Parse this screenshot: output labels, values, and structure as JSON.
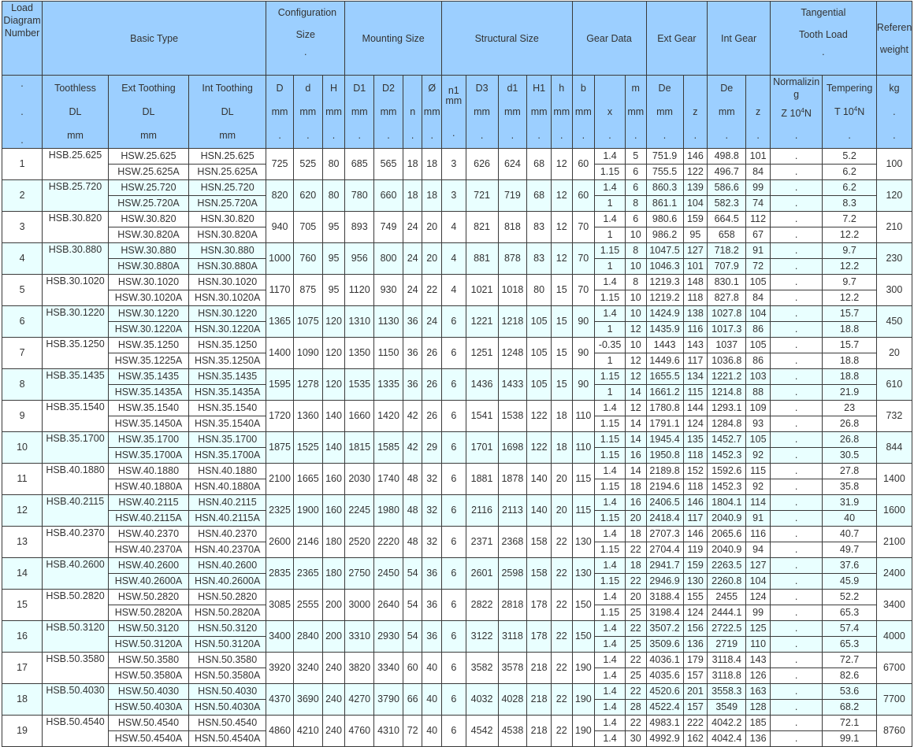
{
  "header": {
    "load_diagram": "Load Diagram Number",
    "basic_type": "Basic Type",
    "configuration_size": "Configuration Size",
    "mounting_size": "Mounting Size",
    "structural_size": "Structural Size",
    "gear_data": "Gear Data",
    "ext_gear": "Ext Gear",
    "int_gear": "Int Gear",
    "tangential_tooth_load": "Tangential Tooth Load",
    "reference_weight": "Reference weight",
    "dot": ".",
    "toothless": "Toothless",
    "toothless_dl": "DL",
    "toothless_mm": "mm",
    "ext_toothing": "Ext Toothing",
    "ext_dl": "DL",
    "ext_mm": "mm",
    "int_toothing": "Int Toothing",
    "int_dl": "DL",
    "int_mm": "mm",
    "D": "D",
    "d": "d",
    "H": "H",
    "D1": "D1",
    "D2": "D2",
    "n": "n",
    "phi": "Ø",
    "n1": "n1",
    "D3": "D3",
    "d1": "d1",
    "H1": "H1",
    "h": "h",
    "b": "b",
    "x": "x",
    "m": "m",
    "De_ext": "De",
    "z_ext": "z",
    "De_int": "De",
    "z_int": "z",
    "mm": "mm",
    "normalizing": "Normalizing",
    "normalizing_unit": "Z 10",
    "tempering": "Tempering",
    "tempering_unit": "T 10",
    "power": "4",
    "newton": "N",
    "kg": "kg"
  },
  "rows": [
    {
      "no": "1",
      "tl": "HSB.25.625",
      "ext": [
        "HSW.25.625",
        "HSW.25.625A"
      ],
      "int": [
        "HSN.25.625",
        "HSN.25.625A"
      ],
      "D": "725",
      "d": "525",
      "H": "80",
      "D1": "685",
      "D2": "565",
      "n": "18",
      "phi": "18",
      "n1": "3",
      "D3": "626",
      "d1": "624",
      "H1": "68",
      "h": "12",
      "b": "60",
      "x": [
        "1.4",
        "1.15"
      ],
      "m": [
        "5",
        "6"
      ],
      "De": [
        "751.9",
        "755.5"
      ],
      "z": [
        "146",
        "122"
      ],
      "Dei": [
        "498.8",
        "496.7"
      ],
      "zi": [
        "101",
        "84"
      ],
      "norm": [
        ".",
        "."
      ],
      "temp": [
        "5.2",
        "6.2"
      ],
      "kg": "100"
    },
    {
      "no": "2",
      "tl": "HSB.25.720",
      "ext": [
        "HSW.25.720",
        "HSW.25.720A"
      ],
      "int": [
        "HSN.25.720",
        "HSN.25.720A"
      ],
      "D": "820",
      "d": "620",
      "H": "80",
      "D1": "780",
      "D2": "660",
      "n": "18",
      "phi": "18",
      "n1": "3",
      "D3": "721",
      "d1": "719",
      "H1": "68",
      "h": "12",
      "b": "60",
      "x": [
        "1.4",
        "1"
      ],
      "m": [
        "6",
        "8"
      ],
      "De": [
        "860.3",
        "861.1"
      ],
      "z": [
        "139",
        "104"
      ],
      "Dei": [
        "586.6",
        "582.3"
      ],
      "zi": [
        "99",
        "74"
      ],
      "norm": [
        ".",
        "."
      ],
      "temp": [
        "6.2",
        "8.3"
      ],
      "kg": "120"
    },
    {
      "no": "3",
      "tl": "HSB.30.820",
      "ext": [
        "HSW.30.820",
        "HSW.30.820A"
      ],
      "int": [
        "HSN.30.820",
        "HSN.30.820A"
      ],
      "D": "940",
      "d": "705",
      "H": "95",
      "D1": "893",
      "D2": "749",
      "n": "24",
      "phi": "20",
      "n1": "4",
      "D3": "821",
      "d1": "818",
      "H1": "83",
      "h": "12",
      "b": "70",
      "x": [
        "1.4",
        "1"
      ],
      "m": [
        "6",
        "10"
      ],
      "De": [
        "980.6",
        "986.2"
      ],
      "z": [
        "159",
        "95"
      ],
      "Dei": [
        "664.5",
        "658"
      ],
      "zi": [
        "112",
        "67"
      ],
      "norm": [
        ".",
        "."
      ],
      "temp": [
        "7.2",
        "12.2"
      ],
      "kg": "210"
    },
    {
      "no": "4",
      "tl": "HSB.30.880",
      "ext": [
        "HSW.30.880",
        "HSW.30.880A"
      ],
      "int": [
        "HSN.30.880",
        "HSN.30.880A"
      ],
      "D": "1000",
      "d": "760",
      "H": "95",
      "D1": "956",
      "D2": "800",
      "n": "24",
      "phi": "20",
      "n1": "4",
      "D3": "881",
      "d1": "878",
      "H1": "83",
      "h": "12",
      "b": "70",
      "x": [
        "1.15",
        "1"
      ],
      "m": [
        "8",
        "10"
      ],
      "De": [
        "1047.5",
        "1046.3"
      ],
      "z": [
        "127",
        "101"
      ],
      "Dei": [
        "718.2",
        "707.9"
      ],
      "zi": [
        "91",
        "72"
      ],
      "norm": [
        ".",
        "."
      ],
      "temp": [
        "9.7",
        "12.2"
      ],
      "kg": "230"
    },
    {
      "no": "5",
      "tl": "HSB.30.1020",
      "ext": [
        "HSW.30.1020",
        "HSW.30.1020A"
      ],
      "int": [
        "HSN.30.1020",
        "HSN.30.1020A"
      ],
      "D": "1170",
      "d": "875",
      "H": "95",
      "D1": "1120",
      "D2": "930",
      "n": "24",
      "phi": "22",
      "n1": "4",
      "D3": "1021",
      "d1": "1018",
      "H1": "80",
      "h": "15",
      "b": "70",
      "x": [
        "1.4",
        "1.15"
      ],
      "m": [
        "8",
        "10"
      ],
      "De": [
        "1219.3",
        "1219.2"
      ],
      "z": [
        "148",
        "118"
      ],
      "Dei": [
        "830.1",
        "827.8"
      ],
      "zi": [
        "105",
        "84"
      ],
      "norm": [
        ".",
        "."
      ],
      "temp": [
        "9.7",
        "12.2"
      ],
      "kg": "300"
    },
    {
      "no": "6",
      "tl": "HSB.30.1220",
      "ext": [
        "HSW.30.1220",
        "HSW.30.1220A"
      ],
      "int": [
        "HSN.30.1220",
        "HSN.30.1220A"
      ],
      "D": "1365",
      "d": "1075",
      "H": "120",
      "D1": "1310",
      "D2": "1130",
      "n": "36",
      "phi": "24",
      "n1": "6",
      "D3": "1221",
      "d1": "1218",
      "H1": "105",
      "h": "15",
      "b": "90",
      "x": [
        "1.4",
        "1"
      ],
      "m": [
        "10",
        "12"
      ],
      "De": [
        "1424.9",
        "1435.9"
      ],
      "z": [
        "138",
        "116"
      ],
      "Dei": [
        "1027.8",
        "1017.3"
      ],
      "zi": [
        "104",
        "86"
      ],
      "norm": [
        ".",
        "."
      ],
      "temp": [
        "15.7",
        "18.8"
      ],
      "kg": "450"
    },
    {
      "no": "7",
      "tl": "HSB.35.1250",
      "ext": [
        "HSW.35.1250",
        "HSW.35.1225A"
      ],
      "int": [
        "HSN.35.1250",
        "HSN.35.1250A"
      ],
      "D": "1400",
      "d": "1090",
      "H": "120",
      "D1": "1350",
      "D2": "1150",
      "n": "36",
      "phi": "26",
      "n1": "6",
      "D3": "1251",
      "d1": "1248",
      "H1": "105",
      "h": "15",
      "b": "90",
      "x": [
        "-0.35",
        "1"
      ],
      "m": [
        "10",
        "12"
      ],
      "De": [
        "1443",
        "1449.6"
      ],
      "z": [
        "143",
        "117"
      ],
      "Dei": [
        "1037",
        "1036.8"
      ],
      "zi": [
        "105",
        "86"
      ],
      "norm": [
        ".",
        "."
      ],
      "temp": [
        "15.7",
        "18.8"
      ],
      "kg": "20"
    },
    {
      "no": "8",
      "tl": "HSB.35.1435",
      "ext": [
        "HSW.35.1435",
        "HSW.35.1435A"
      ],
      "int": [
        "HSN.35.1435",
        "HSN.35.1435A"
      ],
      "D": "1595",
      "d": "1278",
      "H": "120",
      "D1": "1535",
      "D2": "1335",
      "n": "36",
      "phi": "26",
      "n1": "6",
      "D3": "1436",
      "d1": "1433",
      "H1": "105",
      "h": "15",
      "b": "90",
      "x": [
        "1.15",
        "1"
      ],
      "m": [
        "12",
        "14"
      ],
      "De": [
        "1655.5",
        "1661.2"
      ],
      "z": [
        "134",
        "115"
      ],
      "Dei": [
        "1221.2",
        "1214.8"
      ],
      "zi": [
        "103",
        "88"
      ],
      "norm": [
        ".",
        "."
      ],
      "temp": [
        "18.8",
        "21.9"
      ],
      "kg": "610"
    },
    {
      "no": "9",
      "tl": "HSB.35.1540",
      "ext": [
        "HSW.35.1540",
        "HSW.35.1450A"
      ],
      "int": [
        "HSN.35.1540",
        "HSN.35.1540A"
      ],
      "D": "1720",
      "d": "1360",
      "H": "140",
      "D1": "1660",
      "D2": "1420",
      "n": "42",
      "phi": "26",
      "n1": "6",
      "D3": "1541",
      "d1": "1538",
      "H1": "122",
      "h": "18",
      "b": "110",
      "x": [
        "1.4",
        "1.15"
      ],
      "m": [
        "12",
        "14"
      ],
      "De": [
        "1780.8",
        "1791.1"
      ],
      "z": [
        "144",
        "124"
      ],
      "Dei": [
        "1293.1",
        "1284.8"
      ],
      "zi": [
        "109",
        "93"
      ],
      "norm": [
        ".",
        "."
      ],
      "temp": [
        "23",
        "26.8"
      ],
      "kg": "732"
    },
    {
      "no": "10",
      "tl": "HSB.35.1700",
      "ext": [
        "HSW.35.1700",
        "HSW.35.1700A"
      ],
      "int": [
        "HSN.35.1700",
        "HSN.35.1700A"
      ],
      "D": "1875",
      "d": "1525",
      "H": "140",
      "D1": "1815",
      "D2": "1585",
      "n": "42",
      "phi": "29",
      "n1": "6",
      "D3": "1701",
      "d1": "1698",
      "H1": "122",
      "h": "18",
      "b": "110",
      "x": [
        "1.15",
        "1.15"
      ],
      "m": [
        "14",
        "16"
      ],
      "De": [
        "1945.4",
        "1950.8"
      ],
      "z": [
        "135",
        "118"
      ],
      "Dei": [
        "1452.7",
        "1452.3"
      ],
      "zi": [
        "105",
        "92"
      ],
      "norm": [
        ".",
        "."
      ],
      "temp": [
        "26.8",
        "30.5"
      ],
      "kg": "844"
    },
    {
      "no": "11",
      "tl": "HSB.40.1880",
      "ext": [
        "HSW.40.1880",
        "HSW.40.1880A"
      ],
      "int": [
        "HSN.40.1880",
        "HSN.40.1880A"
      ],
      "D": "2100",
      "d": "1665",
      "H": "160",
      "D1": "2030",
      "D2": "1740",
      "n": "48",
      "phi": "32",
      "n1": "6",
      "D3": "1881",
      "d1": "1878",
      "H1": "140",
      "h": "20",
      "b": "115",
      "x": [
        "1.4",
        "1.15"
      ],
      "m": [
        "14",
        "18"
      ],
      "De": [
        "2189.8",
        "2194.6"
      ],
      "z": [
        "152",
        "118"
      ],
      "Dei": [
        "1592.6",
        "1452.3"
      ],
      "zi": [
        "115",
        "92"
      ],
      "norm": [
        ".",
        "."
      ],
      "temp": [
        "27.8",
        "35.8"
      ],
      "kg": "1400"
    },
    {
      "no": "12",
      "tl": "HSB.40.2115",
      "ext": [
        "HSW.40.2115",
        "HSW.40.2115A"
      ],
      "int": [
        "HSN.40.2115",
        "HSN.40.2115A"
      ],
      "D": "2325",
      "d": "1900",
      "H": "160",
      "D1": "2245",
      "D2": "1980",
      "n": "48",
      "phi": "32",
      "n1": "6",
      "D3": "2116",
      "d1": "2113",
      "H1": "140",
      "h": "20",
      "b": "115",
      "x": [
        "1.4",
        "1.15"
      ],
      "m": [
        "16",
        "20"
      ],
      "De": [
        "2406.5",
        "2418.4"
      ],
      "z": [
        "146",
        "117"
      ],
      "Dei": [
        "1804.1",
        "2040.9"
      ],
      "zi": [
        "114",
        "91"
      ],
      "norm": [
        ".",
        "."
      ],
      "temp": [
        "31.9",
        "40"
      ],
      "kg": "1600"
    },
    {
      "no": "13",
      "tl": "HSB.40.2370",
      "ext": [
        "HSW.40.2370",
        "HSW.40.2370A"
      ],
      "int": [
        "HSN.40.2370",
        "HSN.40.2370A"
      ],
      "D": "2600",
      "d": "2146",
      "H": "180",
      "D1": "2520",
      "D2": "2220",
      "n": "48",
      "phi": "32",
      "n1": "6",
      "D3": "2371",
      "d1": "2368",
      "H1": "158",
      "h": "22",
      "b": "130",
      "x": [
        "1.4",
        "1.15"
      ],
      "m": [
        "18",
        "22"
      ],
      "De": [
        "2707.3",
        "2704.4"
      ],
      "z": [
        "146",
        "119"
      ],
      "Dei": [
        "2065.6",
        "2040.9"
      ],
      "zi": [
        "116",
        "94"
      ],
      "norm": [
        ".",
        "."
      ],
      "temp": [
        "40.7",
        "49.7"
      ],
      "kg": "2100"
    },
    {
      "no": "14",
      "tl": "HSB.40.2600",
      "ext": [
        "HSW.40.2600",
        "HSW.40.2600A"
      ],
      "int": [
        "HSN.40.2600",
        "HSN.40.2600A"
      ],
      "D": "2835",
      "d": "2365",
      "H": "180",
      "D1": "2750",
      "D2": "2450",
      "n": "54",
      "phi": "36",
      "n1": "6",
      "D3": "2601",
      "d1": "2598",
      "H1": "158",
      "h": "22",
      "b": "130",
      "x": [
        "1.4",
        "1.15"
      ],
      "m": [
        "18",
        "22"
      ],
      "De": [
        "2941.7",
        "2946.9"
      ],
      "z": [
        "159",
        "130"
      ],
      "Dei": [
        "2263.5",
        "2260.8"
      ],
      "zi": [
        "127",
        "104"
      ],
      "norm": [
        ".",
        "."
      ],
      "temp": [
        "37.6",
        "45.9"
      ],
      "kg": "2400"
    },
    {
      "no": "15",
      "tl": "HSB.50.2820",
      "ext": [
        "HSW.50.2820",
        "HSW.50.2820A"
      ],
      "int": [
        "HSN.50.2820",
        "HSN.50.2820A"
      ],
      "D": "3085",
      "d": "2555",
      "H": "200",
      "D1": "3000",
      "D2": "2640",
      "n": "54",
      "phi": "36",
      "n1": "6",
      "D3": "2822",
      "d1": "2818",
      "H1": "178",
      "h": "22",
      "b": "150",
      "x": [
        "1.4",
        "1.15"
      ],
      "m": [
        "20",
        "25"
      ],
      "De": [
        "3188.4",
        "3198.4"
      ],
      "z": [
        "155",
        "124"
      ],
      "Dei": [
        "2455",
        "2444.1"
      ],
      "zi": [
        "124",
        "99"
      ],
      "norm": [
        ".",
        "."
      ],
      "temp": [
        "52.2",
        "65.3"
      ],
      "kg": "3400"
    },
    {
      "no": "16",
      "tl": "HSB.50.3120",
      "ext": [
        "HSW.50.3120",
        "HSW.50.3120A"
      ],
      "int": [
        "HSN.50.3120",
        "HSN.50.3120A"
      ],
      "D": "3400",
      "d": "2840",
      "H": "200",
      "D1": "3310",
      "D2": "2930",
      "n": "54",
      "phi": "36",
      "n1": "6",
      "D3": "3122",
      "d1": "3118",
      "H1": "178",
      "h": "22",
      "b": "150",
      "x": [
        "1.4",
        "1.4"
      ],
      "m": [
        "22",
        "25"
      ],
      "De": [
        "3507.2",
        "3509.6"
      ],
      "z": [
        "156",
        "136"
      ],
      "Dei": [
        "2722.5",
        "2719"
      ],
      "zi": [
        "125",
        "110"
      ],
      "norm": [
        ".",
        "."
      ],
      "temp": [
        "57.4",
        "65.3"
      ],
      "kg": "4000"
    },
    {
      "no": "17",
      "tl": "HSB.50.3580",
      "ext": [
        "HSW.50.3580",
        "HSW.50.3580A"
      ],
      "int": [
        "HSN.50.3580",
        "HSN.50.3580A"
      ],
      "D": "3920",
      "d": "3240",
      "H": "240",
      "D1": "3820",
      "D2": "3340",
      "n": "60",
      "phi": "40",
      "n1": "6",
      "D3": "3582",
      "d1": "3578",
      "H1": "218",
      "h": "22",
      "b": "190",
      "x": [
        "1.4",
        "1.4"
      ],
      "m": [
        "22",
        "25"
      ],
      "De": [
        "4036.1",
        "4035.6"
      ],
      "z": [
        "179",
        "157"
      ],
      "Dei": [
        "3118.4",
        "3118.8"
      ],
      "zi": [
        "143",
        "126"
      ],
      "norm": [
        ".",
        "."
      ],
      "temp": [
        "72.7",
        "82.6"
      ],
      "kg": "6700"
    },
    {
      "no": "18",
      "tl": "HSB.50.4030",
      "ext": [
        "HSW.50.4030",
        "HSW.50.4030A"
      ],
      "int": [
        "HSN.50.4030",
        "HSN.50.4030A"
      ],
      "D": "4370",
      "d": "3690",
      "H": "240",
      "D1": "4270",
      "D2": "3790",
      "n": "66",
      "phi": "40",
      "n1": "6",
      "D3": "4032",
      "d1": "4028",
      "H1": "218",
      "h": "22",
      "b": "190",
      "x": [
        "1.4",
        "1.4"
      ],
      "m": [
        "22",
        "28"
      ],
      "De": [
        "4520.6",
        "4522.4"
      ],
      "z": [
        "201",
        "157"
      ],
      "Dei": [
        "3558.3",
        "3549"
      ],
      "zi": [
        "163",
        "128"
      ],
      "norm": [
        ".",
        "."
      ],
      "temp": [
        "53.6",
        "68.2"
      ],
      "kg": "7700"
    },
    {
      "no": "19",
      "tl": "HSB.50.4540",
      "ext": [
        "HSW.50.4540",
        "HSW.50.4540A"
      ],
      "int": [
        "HSN.50.4540",
        "HSN.50.4540A"
      ],
      "D": "4860",
      "d": "4210",
      "H": "240",
      "D1": "4760",
      "D2": "4310",
      "n": "72",
      "phi": "40",
      "n1": "6",
      "D3": "4542",
      "d1": "4538",
      "H1": "218",
      "h": "22",
      "b": "190",
      "x": [
        "1.4",
        "1.4"
      ],
      "m": [
        "22",
        "30"
      ],
      "De": [
        "4983.1",
        "4992.9"
      ],
      "z": [
        "222",
        "162"
      ],
      "Dei": [
        "4042.2",
        "4042.4"
      ],
      "zi": [
        "185",
        "136"
      ],
      "norm": [
        ".",
        "."
      ],
      "temp": [
        "72.1",
        "99.1"
      ],
      "kg": "8760"
    }
  ],
  "colors": {
    "header_bg": "#9ccfff",
    "alt_row_bg": "#e9ffff",
    "border": "#3a3a3a"
  }
}
